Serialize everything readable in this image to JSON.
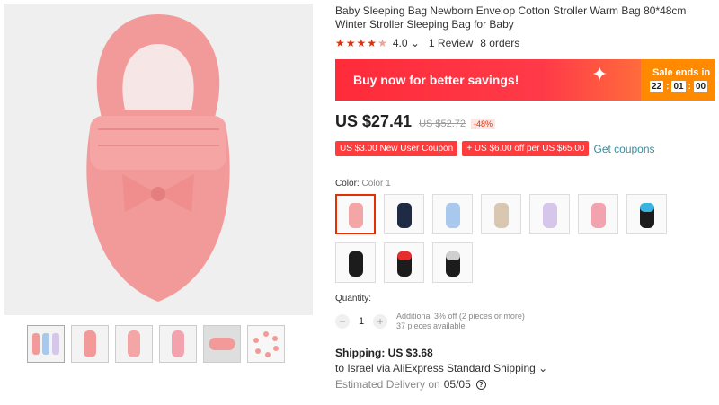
{
  "product": {
    "title": "Baby Sleeping Bag Newborn Envelop Cotton Stroller Warm Bag 80*48cm Winter Stroller Sleeping Bag for Baby",
    "rating_value": "4.0",
    "rating_stars": 4,
    "reviews": "1 Review",
    "orders": "8 orders"
  },
  "banner": {
    "text": "Buy now for better savings!",
    "sale_label": "Sale ends in",
    "timer": [
      "22",
      "01",
      "00"
    ]
  },
  "price": {
    "current": "US $27.41",
    "original": "US $52.72",
    "discount": "-48%"
  },
  "coupons": {
    "items": [
      "US $3.00 New User Coupon",
      "+ US $6.00 off per US $65.00"
    ],
    "get_label": "Get coupons"
  },
  "color": {
    "label": "Color:",
    "value": "Color 1",
    "swatches": [
      {
        "body": "#f4a6a6",
        "top": "#f4a6a6"
      },
      {
        "body": "#1f2a44",
        "top": "#1f2a44"
      },
      {
        "body": "#a9c8ee",
        "top": "#a9c8ee"
      },
      {
        "body": "#d9c7b2",
        "top": "#d9c7b2"
      },
      {
        "body": "#d6c6ec",
        "top": "#d6c6ec"
      },
      {
        "body": "#f3a3ad",
        "top": "#f3a3ad"
      },
      {
        "body": "#1c1c1c",
        "top": "#3bb3e0"
      },
      {
        "body": "#1c1c1c",
        "top": "#1c1c1c"
      },
      {
        "body": "#1c1c1c",
        "top": "#e62e2e"
      },
      {
        "body": "#1c1c1c",
        "top": "#cfcfcf"
      }
    ]
  },
  "quantity": {
    "label": "Quantity:",
    "value": "1",
    "note_line1": "Additional 3% off (2 pieces or more)",
    "note_line2": "37 pieces available"
  },
  "shipping": {
    "title": "Shipping: US $3.68",
    "destination": "to Israel via AliExpress Standard Shipping",
    "delivery_label": "Estimated Delivery on",
    "delivery_date": "05/05"
  },
  "colors": {
    "accent": "#e62e04",
    "banner": "#ff2b3a",
    "sale": "#ff8a00",
    "product_pink": "#f4a6a6"
  }
}
